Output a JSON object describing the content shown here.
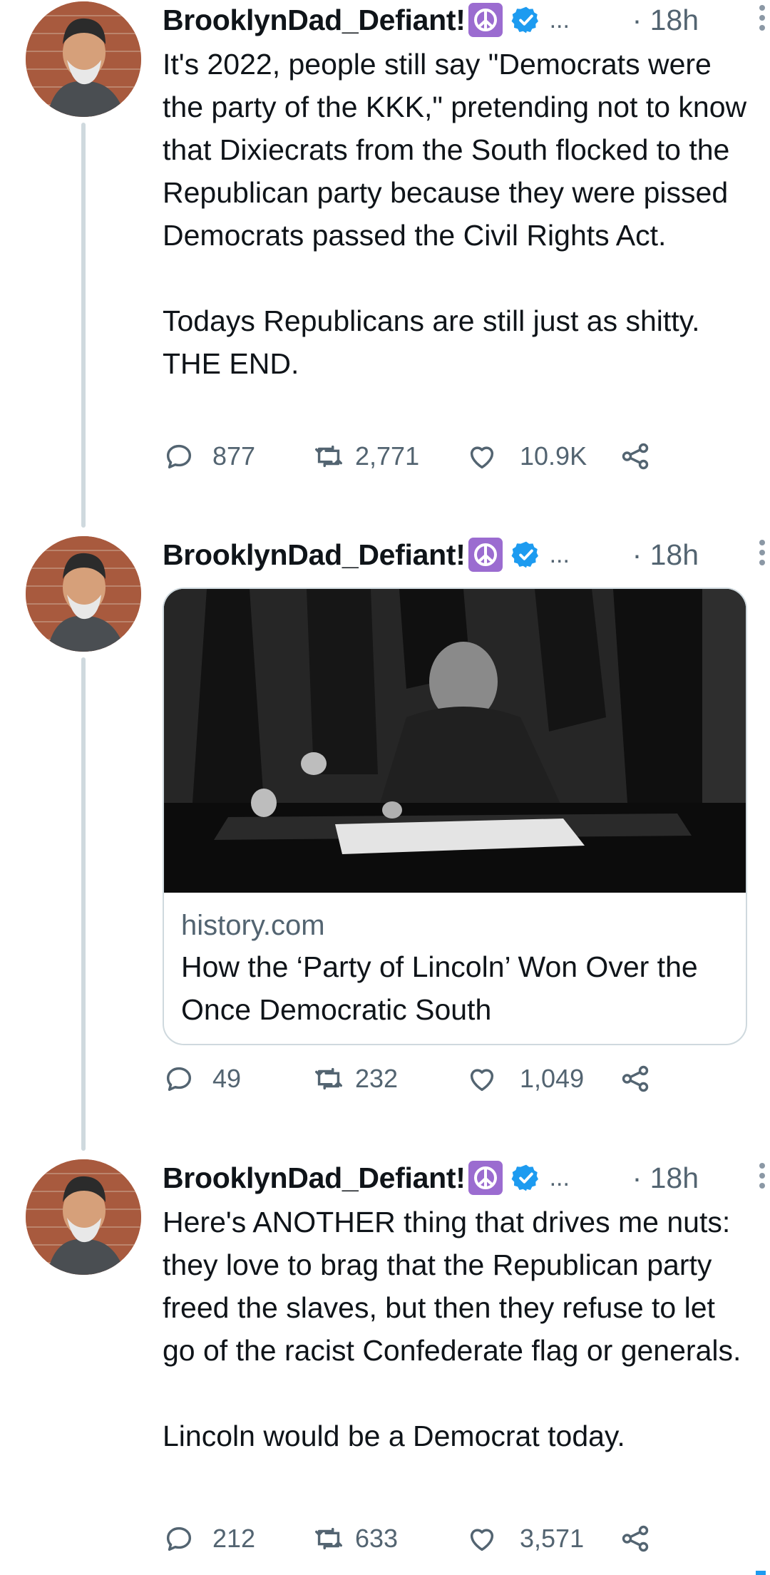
{
  "colors": {
    "accent": "#1d9bf0",
    "secondary_text": "#536471",
    "peace_badge": "#9b6cd0"
  },
  "tweets": [
    {
      "author": "BrooklynDad_Defiant!",
      "handle_ellipsis": "...",
      "time": "· 18h",
      "text": [
        "It's 2022, people still say \"Democrats were the party of the KKK,\" pretending not to know that Dixiecrats from the South flocked to the Republican party because they were pissed Democrats passed the Civil Rights Act.",
        "Todays Republicans are still just as shitty. THE END."
      ],
      "replies": "877",
      "retweets": "2,771",
      "likes": "10.9K"
    },
    {
      "author": "BrooklynDad_Defiant!",
      "handle_ellipsis": "...",
      "time": "· 18h",
      "card": {
        "domain": "history.com",
        "title": "How the ‘Party of Lincoln’ Won Over the Once Democratic South"
      },
      "replies": "49",
      "retweets": "232",
      "likes": "1,049"
    },
    {
      "author": "BrooklynDad_Defiant!",
      "handle_ellipsis": "...",
      "time": "· 18h",
      "text": [
        "Here's ANOTHER thing that drives me nuts: they love to brag that the Republican party freed the slaves, but then they refuse to let go of the racist Confederate flag or generals.",
        "Lincoln would be a Democrat today."
      ],
      "replies": "212",
      "retweets": "633",
      "likes": "3,571"
    }
  ]
}
